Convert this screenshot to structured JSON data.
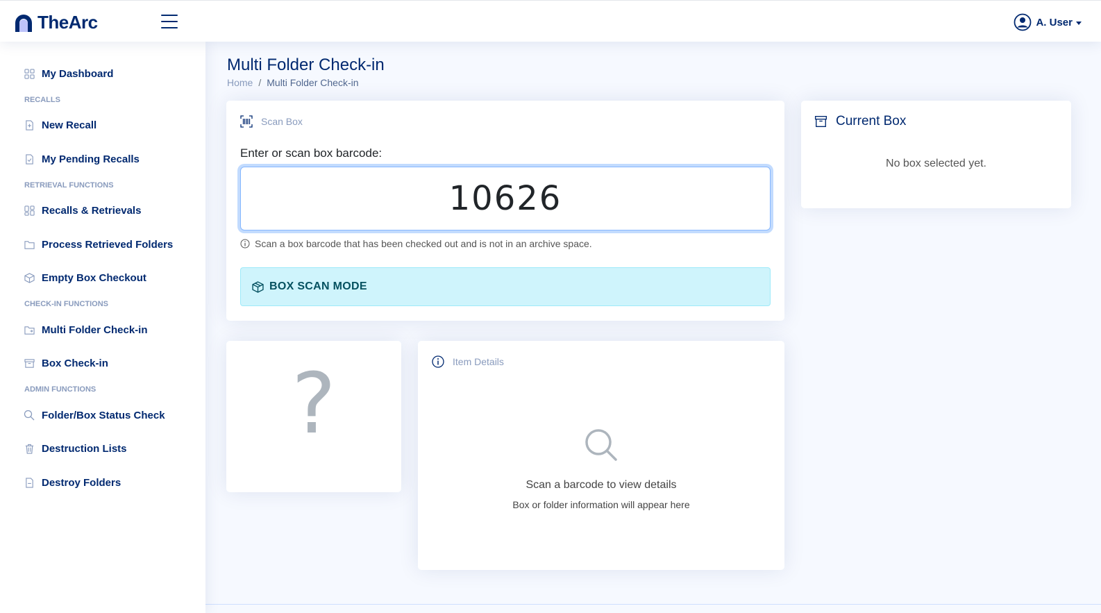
{
  "header": {
    "brand": "TheArc",
    "user_name": "A. User",
    "icons": {
      "logo": "arc-logo",
      "menu": "hamburger-icon",
      "user": "user-circle-icon"
    }
  },
  "sidebar": {
    "items": [
      {
        "type": "item",
        "label": "My Dashboard",
        "icon": "grid-icon"
      },
      {
        "type": "heading",
        "label": "RECALLS"
      },
      {
        "type": "item",
        "label": "New Recall",
        "icon": "file-plus-icon"
      },
      {
        "type": "item",
        "label": "My Pending Recalls",
        "icon": "file-check-icon"
      },
      {
        "type": "heading",
        "label": "RETRIEVAL FUNCTIONS"
      },
      {
        "type": "item",
        "label": "Recalls & Retrievals",
        "icon": "grid-icon"
      },
      {
        "type": "item",
        "label": "Process Retrieved Folders",
        "icon": "folder-icon"
      },
      {
        "type": "item",
        "label": "Empty Box Checkout",
        "icon": "box-icon"
      },
      {
        "type": "heading",
        "label": "CHECK-IN FUNCTIONS"
      },
      {
        "type": "item",
        "label": "Multi Folder Check-in",
        "icon": "folder-symlink-icon"
      },
      {
        "type": "item",
        "label": "Box Check-in",
        "icon": "archive-icon"
      },
      {
        "type": "heading",
        "label": "ADMIN FUNCTIONS"
      },
      {
        "type": "item",
        "label": "Folder/Box Status Check",
        "icon": "search-icon"
      },
      {
        "type": "item",
        "label": "Destruction Lists",
        "icon": "trash-icon"
      },
      {
        "type": "item",
        "label": "Destroy Folders",
        "icon": "file-minus-icon"
      }
    ]
  },
  "page": {
    "title": "Multi Folder Check-in",
    "breadcrumb": {
      "home": "Home",
      "separator": "/",
      "current": "Multi Folder Check-in"
    }
  },
  "scan": {
    "header": "Scan Box",
    "label": "Enter or scan box barcode:",
    "value": "10626",
    "hint": "Scan a box barcode that has been checked out and is not in an archive space.",
    "mode": "BOX SCAN MODE"
  },
  "current_box": {
    "title": "Current Box",
    "empty": "No box selected yet."
  },
  "preview": {
    "symbol": "?"
  },
  "details": {
    "header": "Item Details",
    "main": "Scan a barcode to view details",
    "sub": "Box or folder information will appear here"
  },
  "colors": {
    "brand": "#012970",
    "muted": "#899bbd",
    "info_bg": "#cff4fc",
    "info_text": "#055160",
    "background": "#f6f9ff"
  }
}
